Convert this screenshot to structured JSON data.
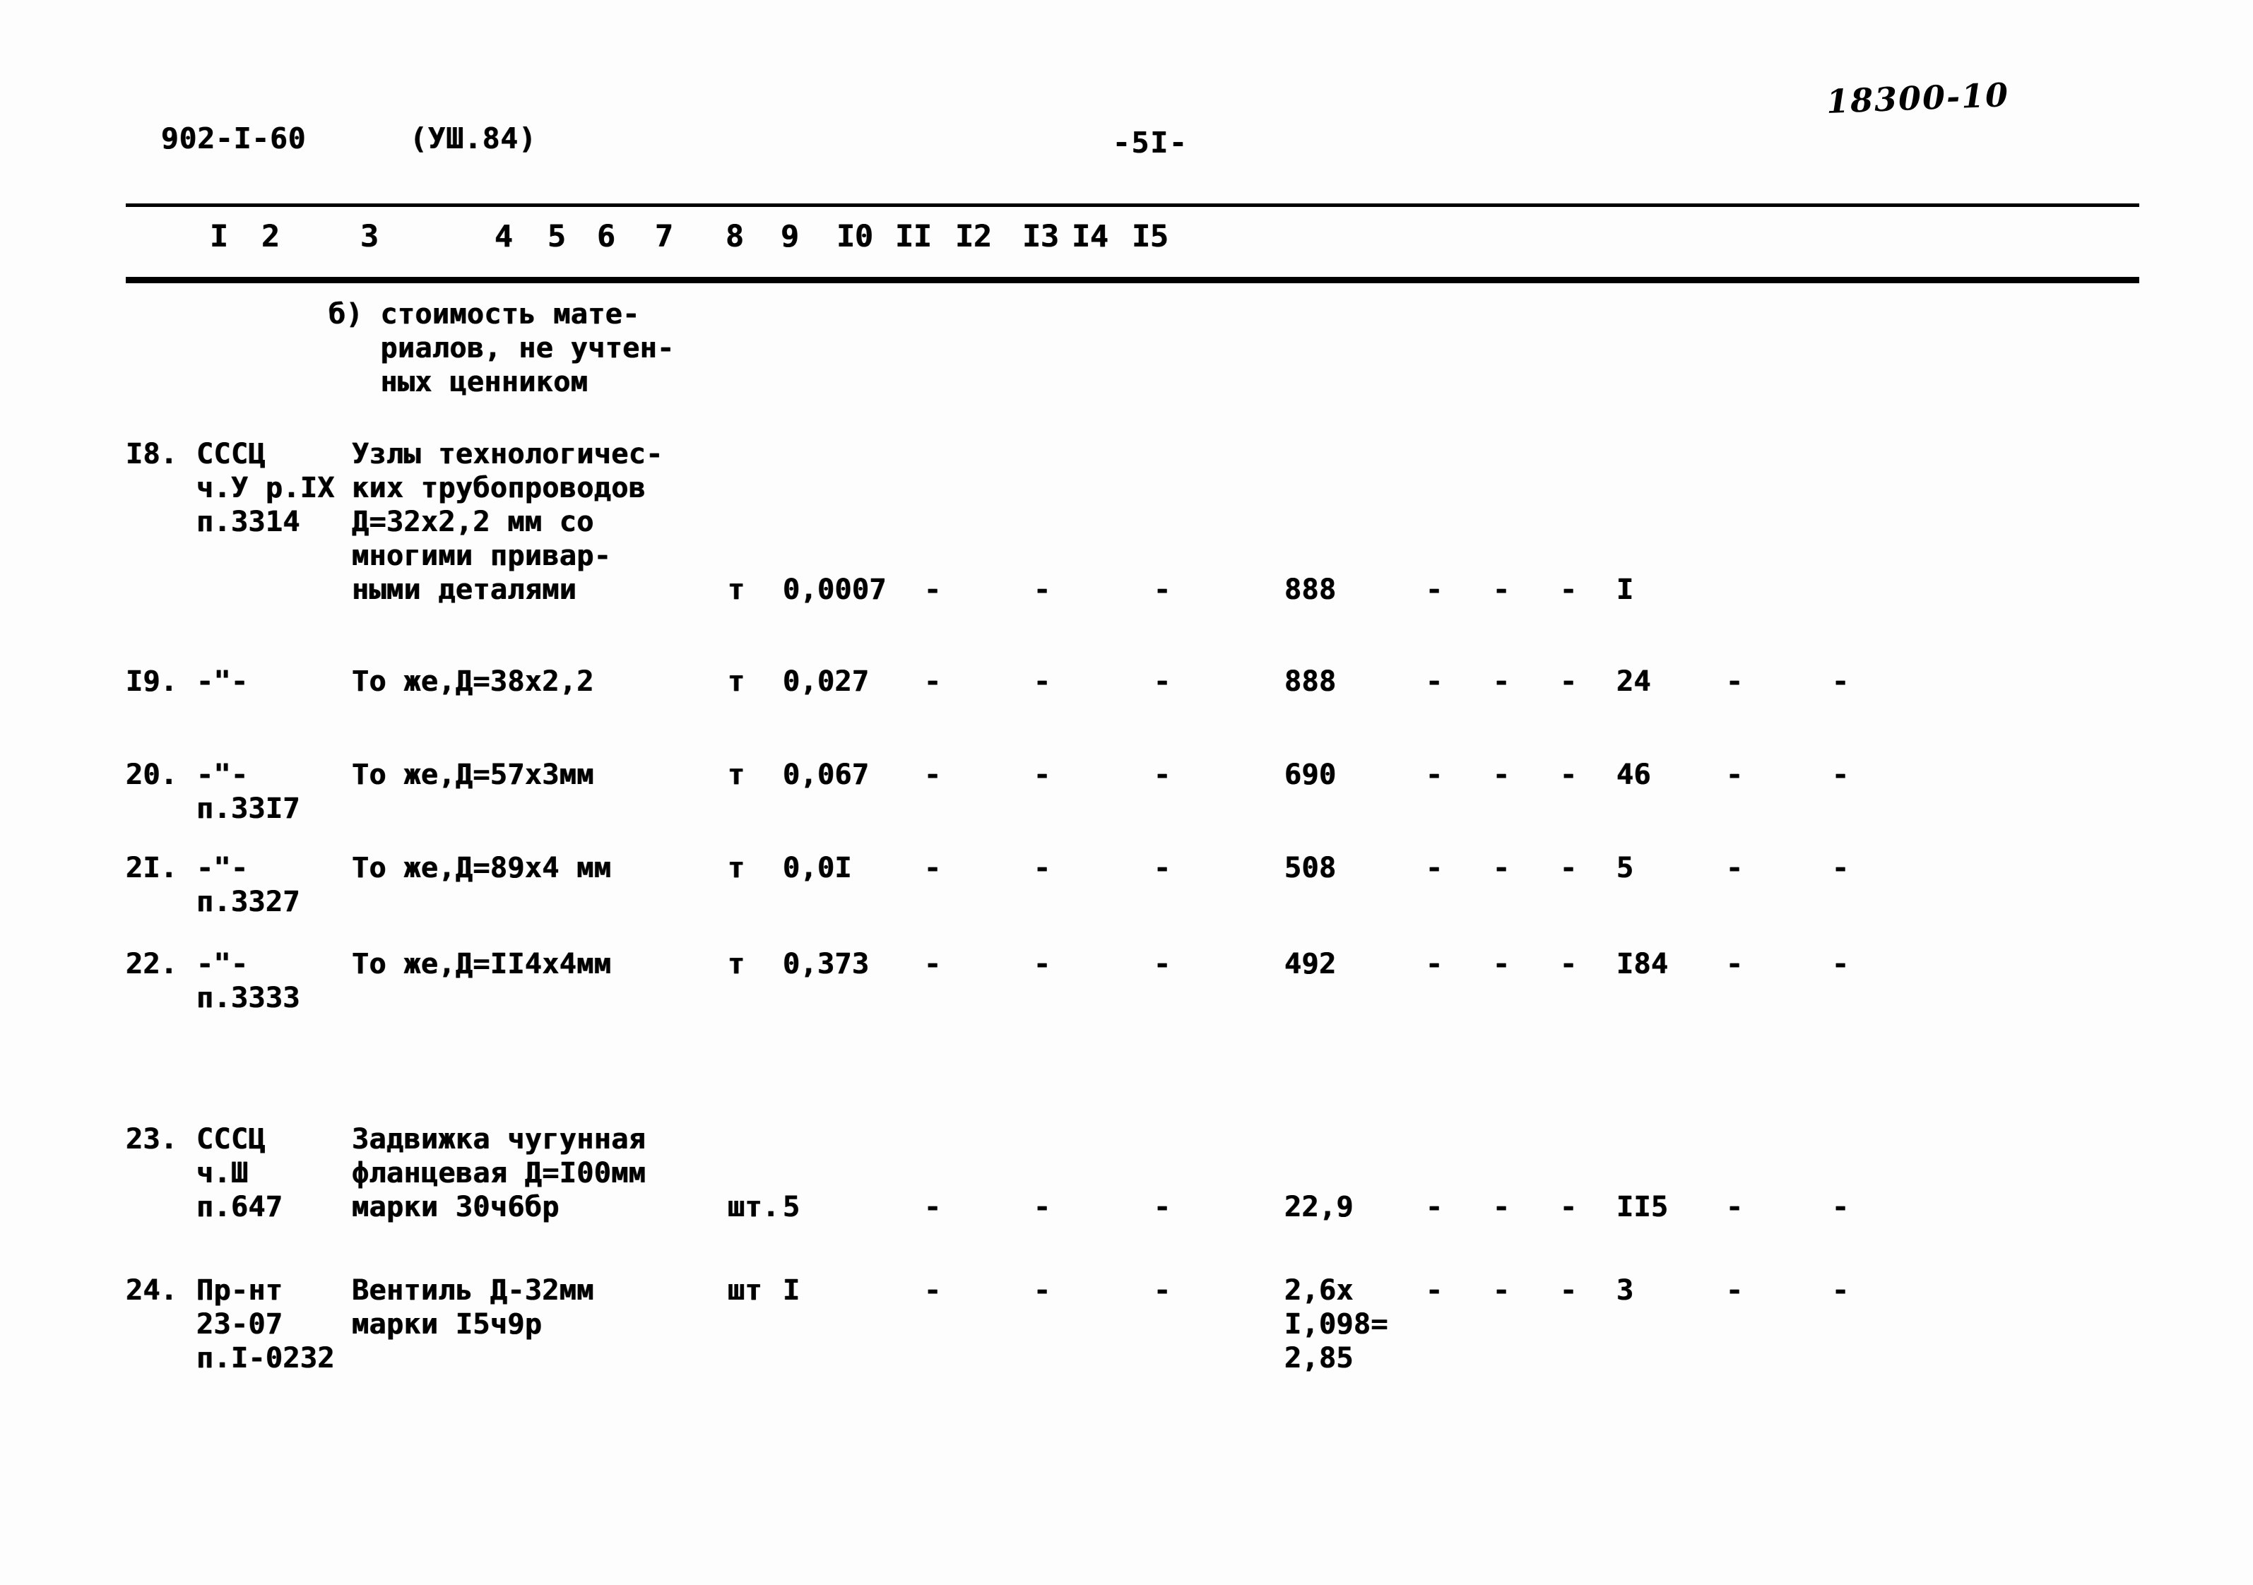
{
  "header": {
    "doc_code": "902-I-60",
    "doc_variant": "(УШ.84)",
    "page_number": "-5I-",
    "handwritten_note": "18300-10"
  },
  "table": {
    "column_numbers": [
      "I",
      "2",
      "3",
      "4",
      "5",
      "6",
      "7",
      "8",
      "9",
      "I0",
      "II",
      "I2",
      "I3",
      "I4",
      "I5"
    ],
    "dash": "-",
    "section_note": "б) стоимость мате-\n   риалов, не учтен-\n   ных ценником",
    "rows": [
      {
        "num": "I8.",
        "ref": "СССЦ\nч.У р.IX\nп.3314",
        "desc": "Узлы технологичес-\nких трубопроводов\nД=32х2,2 мм со\nмногими привар-\nными деталями",
        "unit": "т",
        "qty": "0,0007",
        "c6": "-",
        "c7": "-",
        "c8": "-",
        "c9": "888",
        "c10": "-",
        "c11": "-",
        "c12": "-",
        "c13": "I",
        "c14": "",
        "c15": ""
      },
      {
        "num": "I9.",
        "ref": "-\"-",
        "desc": "То же,Д=38х2,2",
        "unit": "т",
        "qty": "0,027",
        "c6": "-",
        "c7": "-",
        "c8": "-",
        "c9": "888",
        "c10": "-",
        "c11": "-",
        "c12": "-",
        "c13": "24",
        "c14": "-",
        "c15": "-"
      },
      {
        "num": "20.",
        "ref": "-\"-\nп.33I7",
        "desc": "То же,Д=57х3мм",
        "unit": "т",
        "qty": "0,067",
        "c6": "-",
        "c7": "-",
        "c8": "-",
        "c9": "690",
        "c10": "-",
        "c11": "-",
        "c12": "-",
        "c13": "46",
        "c14": "-",
        "c15": "-"
      },
      {
        "num": "2I.",
        "ref": "-\"-\nп.3327",
        "desc": "То же,Д=89х4 мм",
        "unit": "т",
        "qty": "0,0I",
        "c6": "-",
        "c7": "-",
        "c8": "-",
        "c9": "508",
        "c10": "-",
        "c11": "-",
        "c12": "-",
        "c13": "5",
        "c14": "-",
        "c15": "-"
      },
      {
        "num": "22.",
        "ref": "-\"-\nп.3333",
        "desc": "То же,Д=II4х4мм",
        "unit": "т",
        "qty": "0,373",
        "c6": "-",
        "c7": "-",
        "c8": "-",
        "c9": "492",
        "c10": "-",
        "c11": "-",
        "c12": "-",
        "c13": "I84",
        "c14": "-",
        "c15": "-"
      },
      {
        "num": "23.",
        "ref": "СССЦ\nч.Ш\nп.647",
        "desc": "Задвижка чугунная\nфланцевая Д=I00мм\nмарки 30ч6бр",
        "unit": "шт.",
        "qty": "5",
        "c6": "-",
        "c7": "-",
        "c8": "-",
        "c9": "22,9",
        "c10": "-",
        "c11": "-",
        "c12": "-",
        "c13": "II5",
        "c14": "-",
        "c15": "-"
      },
      {
        "num": "24.",
        "ref": "Пр-нт\n23-07\nп.I-0232",
        "desc": "Вентиль Д-32мм\nмарки I5ч9р",
        "unit": "шт",
        "qty": "I",
        "c6": "-",
        "c7": "-",
        "c8": "-",
        "c9": "2,6х\nI,098=\n2,85",
        "c10": "-",
        "c11": "-",
        "c12": "-",
        "c13": "3",
        "c14": "-",
        "c15": "-"
      }
    ]
  }
}
